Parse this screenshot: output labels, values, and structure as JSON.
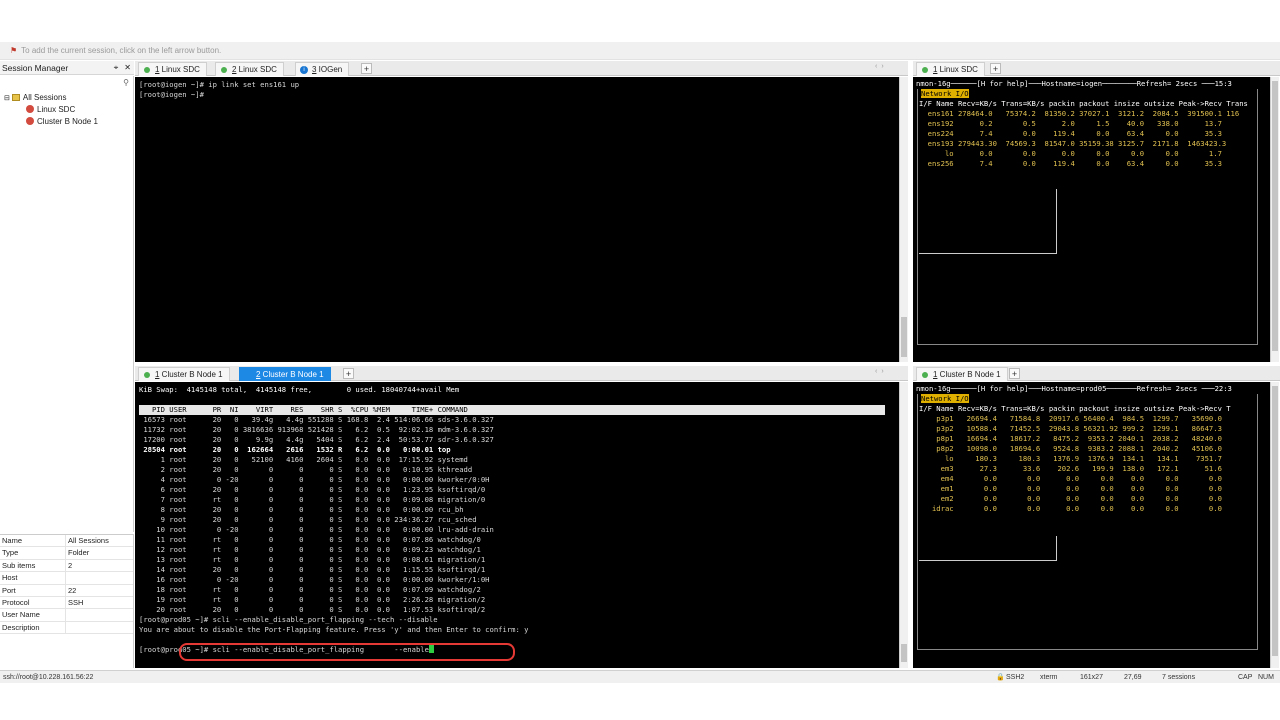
{
  "hint": "To add the current session, click on the left arrow button.",
  "session_manager": {
    "title": "Session Manager",
    "tree": [
      {
        "label": "All Sessions",
        "icon": "folder-icon"
      },
      {
        "label": "Linux SDC",
        "icon": "node-icon"
      },
      {
        "label": "Cluster B Node 1",
        "icon": "node-icon"
      }
    ],
    "properties": [
      {
        "k": "Name",
        "v": "All Sessions"
      },
      {
        "k": "Type",
        "v": "Folder"
      },
      {
        "k": "Sub items",
        "v": "2"
      },
      {
        "k": "Host",
        "v": ""
      },
      {
        "k": "Port",
        "v": "22"
      },
      {
        "k": "Protocol",
        "v": "SSH"
      },
      {
        "k": "User Name",
        "v": ""
      },
      {
        "k": "Description",
        "v": ""
      }
    ]
  },
  "tabs_top_left": [
    {
      "num": "1",
      "label": " Linux SDC"
    },
    {
      "num": "2",
      "label": " Linux SDC"
    },
    {
      "num": "3",
      "label": " IOGen"
    }
  ],
  "tabs_top_right": [
    {
      "num": "1",
      "label": " Linux SDC"
    }
  ],
  "tabs_bottom_left": [
    {
      "num": "1",
      "label": " Cluster B Node 1"
    },
    {
      "num": "2",
      "label": " Cluster B Node 1"
    }
  ],
  "tabs_bottom_right": [
    {
      "num": "1",
      "label": " Cluster B Node 1"
    }
  ],
  "term_top_left": "[root@iogen ~]# ip link set ens161 up\n[root@iogen ~]# ",
  "term_bottom_left": {
    "swap": "KiB Swap:  4145148 total,  4145148 free,        0 used. 18040744+avail Mem",
    "header": "   PID USER      PR  NI    VIRT    RES    SHR S  %CPU %MEM     TIME+ COMMAND                                                ",
    "rows_a": " 16573 root      20   0   39.4g   4.4g 551288 S 168.8  2.4 514:06.66 sds-3.6.0.327\n 11732 root      20   0 3816636 913968 521428 S   6.2  0.5  92:02.18 mdm-3.6.0.327\n 17200 root      20   0    9.9g   4.4g   5404 S   6.2  2.4  50:53.77 sdr-3.6.0.327",
    "row_top": " 28504 root      20   0  162664   2616   1532 R   6.2  0.0   0:00.01 top",
    "rows_b": "     1 root      20   0   52100   4160   2604 S   0.0  0.0  17:15.92 systemd\n     2 root      20   0       0      0      0 S   0.0  0.0   0:10.95 kthreadd\n     4 root       0 -20       0      0      0 S   0.0  0.0   0:00.00 kworker/0:0H\n     6 root      20   0       0      0      0 S   0.0  0.0   1:23.95 ksoftirqd/0\n     7 root      rt   0       0      0      0 S   0.0  0.0   0:09.08 migration/0\n     8 root      20   0       0      0      0 S   0.0  0.0   0:00.00 rcu_bh\n     9 root      20   0       0      0      0 S   0.0  0.0 234:36.27 rcu_sched\n    10 root       0 -20       0      0      0 S   0.0  0.0   0:00.00 lru-add-drain\n    11 root      rt   0       0      0      0 S   0.0  0.0   0:07.86 watchdog/0\n    12 root      rt   0       0      0      0 S   0.0  0.0   0:09.23 watchdog/1\n    13 root      rt   0       0      0      0 S   0.0  0.0   0:08.61 migration/1\n    14 root      20   0       0      0      0 S   0.0  0.0   1:15.55 ksoftirqd/1\n    16 root       0 -20       0      0      0 S   0.0  0.0   0:00.00 kworker/1:0H\n    18 root      rt   0       0      0      0 S   0.0  0.0   0:07.09 watchdog/2\n    19 root      rt   0       0      0      0 S   0.0  0.0   2:26.28 migration/2\n    20 root      20   0       0      0      0 S   0.0  0.0   1:07.53 ksoftirqd/2",
    "cmd1": "[root@prod05 ~]# scli --enable_disable_port_flapping --tech --disable",
    "cmd2": "You are about to disable the Port-Flapping feature. Press 'y' and then Enter to confirm: y",
    "cmd3": "[root@prod05 ~]# scli --enable_disable_port_flapping       --enable"
  },
  "nmon_top": {
    "header": "nmon-16g──────[H for help]───Hostname=iogen────────Refresh= 2secs ───15:3",
    "tag": "Network I/O",
    "cols": "I/F Name Recv=KB/s Trans=KB/s packin packout insize outsize Peak->Recv Trans",
    "rows": [
      "  ens161 278464.0   75374.2  81350.2 37027.1  3121.2  2084.5  391500.1 116",
      "  ens192      0.2       0.5      2.0     1.5    40.0   338.0      13.7",
      "  ens224      7.4       0.0    119.4     0.0    63.4     0.0      35.3",
      "  ens193 279443.30  74569.3  81547.0 35159.38 3125.7  2171.8  1463423.3",
      "      lo      0.0       0.0      0.0     0.0     0.0     0.0       1.7",
      "  ens256      7.4       0.0    119.4     0.0    63.4     0.0      35.3"
    ]
  },
  "nmon_bottom": {
    "header": "nmon-16g──────[H for help]───Hostname=prod05───────Refresh= 2secs ───22:3",
    "tag": "Network I/O",
    "cols": "I/F Name Recv=KB/s Trans=KB/s packin packout insize outsize Peak->Recv T",
    "rows": [
      "    p3p1   26694.4   71584.8  20917.6 56400.4  984.5  1299.7   35690.0",
      "    p3p2   10588.4   71452.5  29043.8 56321.92 999.2  1299.1   86647.3",
      "    p8p1   16694.4   18617.2   8475.2  9353.2 2040.1  2038.2   48240.0",
      "    p8p2   10098.0   18694.6   9524.8  9383.2 2088.1  2040.2   45106.0",
      "      lo     180.3     180.3   1376.9  1376.9  134.1   134.1    7351.7",
      "     em3      27.3      33.6    202.6   199.9  138.0   172.1      51.6",
      "     em4       0.0       0.0      0.0     0.0    0.0     0.0       0.0",
      "     em1       0.0       0.0      0.0     0.0    0.0     0.0       0.0",
      "     em2       0.0       0.0      0.0     0.0    0.0     0.0       0.0",
      "   idrac       0.0       0.0      0.0     0.0    0.0     0.0       0.0"
    ]
  },
  "status": {
    "left": "ssh://root@10.228.161.56:22",
    "ssh": "SSH2",
    "term": "xterm",
    "size": "161x27",
    "pos": "27,69",
    "sessions": "7 sessions",
    "cap": "CAP",
    "num": "NUM"
  },
  "colors": {
    "accent": "#1e88e5",
    "highlight": "#e53935",
    "nmon_tag": "#e0b000"
  }
}
